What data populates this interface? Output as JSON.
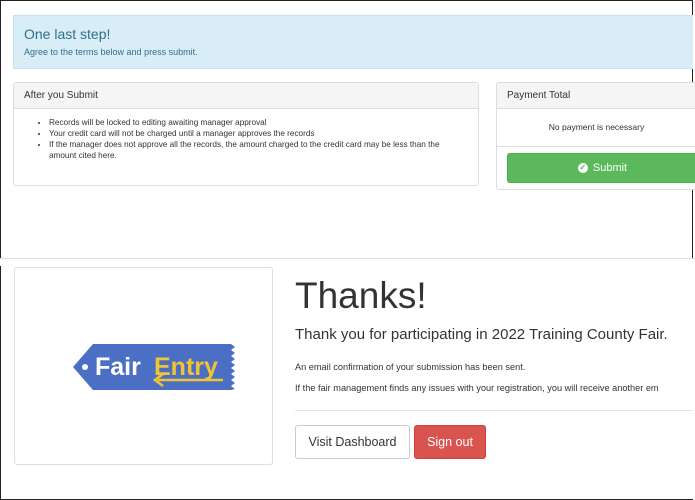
{
  "alert": {
    "title": "One last step!",
    "text": "Agree to the terms below and press submit."
  },
  "after_submit": {
    "heading": "After you Submit",
    "items": [
      "Records will be locked to editing awaiting manager approval",
      "Your credit card will not be charged until a manager approves the records",
      "If the manager does not approve all the records, the amount charged to the credit card may be less than the amount cited here."
    ]
  },
  "payment": {
    "heading": "Payment Total",
    "message": "No payment is necessary",
    "submit_label": "Submit"
  },
  "logo": {
    "text_fair": "Fair",
    "text_entry": "Entry",
    "colors": {
      "tag": "#4a6fc4",
      "fair": "#ffffff",
      "entry": "#f4c430"
    }
  },
  "thanks": {
    "title": "Thanks!",
    "subtitle": "Thank you for participating in 2022 Training County Fair.",
    "line1": "An email confirmation of your submission has been sent.",
    "line2": "If the fair management finds any issues with your registration, you will receive another em"
  },
  "buttons": {
    "dashboard": "Visit Dashboard",
    "signout": "Sign out"
  }
}
